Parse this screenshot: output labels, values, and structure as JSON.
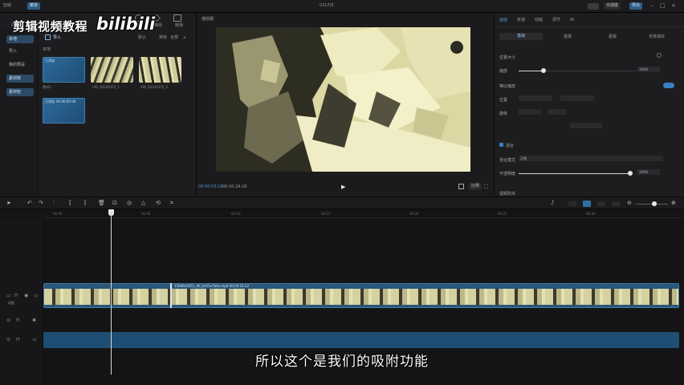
{
  "window": {
    "app_menu": "剪映",
    "layout_button": "菜单",
    "title": "0317日",
    "shortcut_button": "快捷键",
    "export_button": "导出"
  },
  "watermark": {
    "text": "剪辑视频教程",
    "logo": "bilibili"
  },
  "media": {
    "top_tabs": [
      "媒体",
      "音频",
      "文本",
      "贴纸",
      "特效",
      "转场"
    ],
    "import_label": "导入",
    "toolbar": [
      "默认",
      "排序",
      "全部"
    ],
    "sidebar": [
      "本地",
      "导入",
      "我的预设",
      "素材库",
      "素材包"
    ],
    "section_label": "本地",
    "items": [
      {
        "badge": "已添加",
        "name": "素材1"
      },
      {
        "name": "VID_20230315_1"
      },
      {
        "name": "VID_20230315_2"
      },
      {
        "badge": "已添加",
        "name": "00:00:05:00"
      }
    ]
  },
  "player": {
    "title": "播放器",
    "timecode": "00:00:24:26",
    "current": "00:00:03:18",
    "ratio_button": "比例"
  },
  "inspector": {
    "tabs": [
      "画面",
      "变速",
      "动画",
      "调节",
      "AI"
    ],
    "subtabs": [
      "基础",
      "抠像",
      "蒙版",
      "背景填充"
    ],
    "section_position": "位置大小",
    "scale_label": "缩放",
    "scale_value": "100%",
    "uniform_label": "等比缩放",
    "pos_label": "位置",
    "rotate_label": "旋转",
    "blend_section": "混合",
    "blend_mode_label": "混合模式",
    "blend_mode_value": "正常",
    "opacity_label": "不透明度",
    "opacity_value": "100%",
    "stabilize_label": "视频防抖"
  },
  "timeline": {
    "ruler_ticks": [
      "00:00",
      "00:05",
      "00:10",
      "00:15",
      "00:20",
      "00:25",
      "00:30"
    ],
    "clip_label": "1584643451_00_0e55e7b4e.mp4  00:00:21:22",
    "cover_label": "封面"
  },
  "subtitle": "所以这个是我们的吸附功能"
}
